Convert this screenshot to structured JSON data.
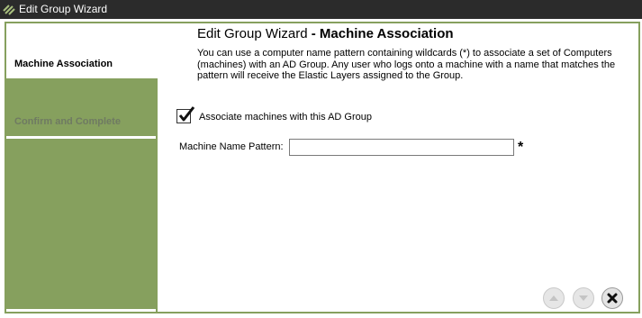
{
  "window": {
    "title": "Edit Group Wizard"
  },
  "steps": [
    {
      "label": "Machine Association",
      "state": "active"
    },
    {
      "label": "Confirm and Complete",
      "state": "inactive"
    }
  ],
  "main": {
    "title": "Edit Group Wizard",
    "title_separator": " - ",
    "subtitle": "Machine Association",
    "description": "You can use a computer name pattern containing wildcards (*) to associate a set of Computers (machines) with an AD Group. Any user who logs onto a machine with a name that matches the pattern will receive the Elastic Layers assigned to the Group.",
    "associate_checkbox": {
      "label": "Associate machines with this AD Group",
      "checked": true
    },
    "machine_name_pattern": {
      "label": "Machine Name Pattern:",
      "value": "",
      "required_marker": "*"
    }
  },
  "footer": {
    "buttons": [
      {
        "icon": "up-arrow-icon",
        "enabled": false
      },
      {
        "icon": "down-arrow-icon",
        "enabled": false
      },
      {
        "icon": "close-icon",
        "enabled": true
      }
    ]
  },
  "colors": {
    "accent": "#86a05e",
    "titlebar": "#2b2b2b",
    "inactive_step_text": "#6f7a62"
  }
}
